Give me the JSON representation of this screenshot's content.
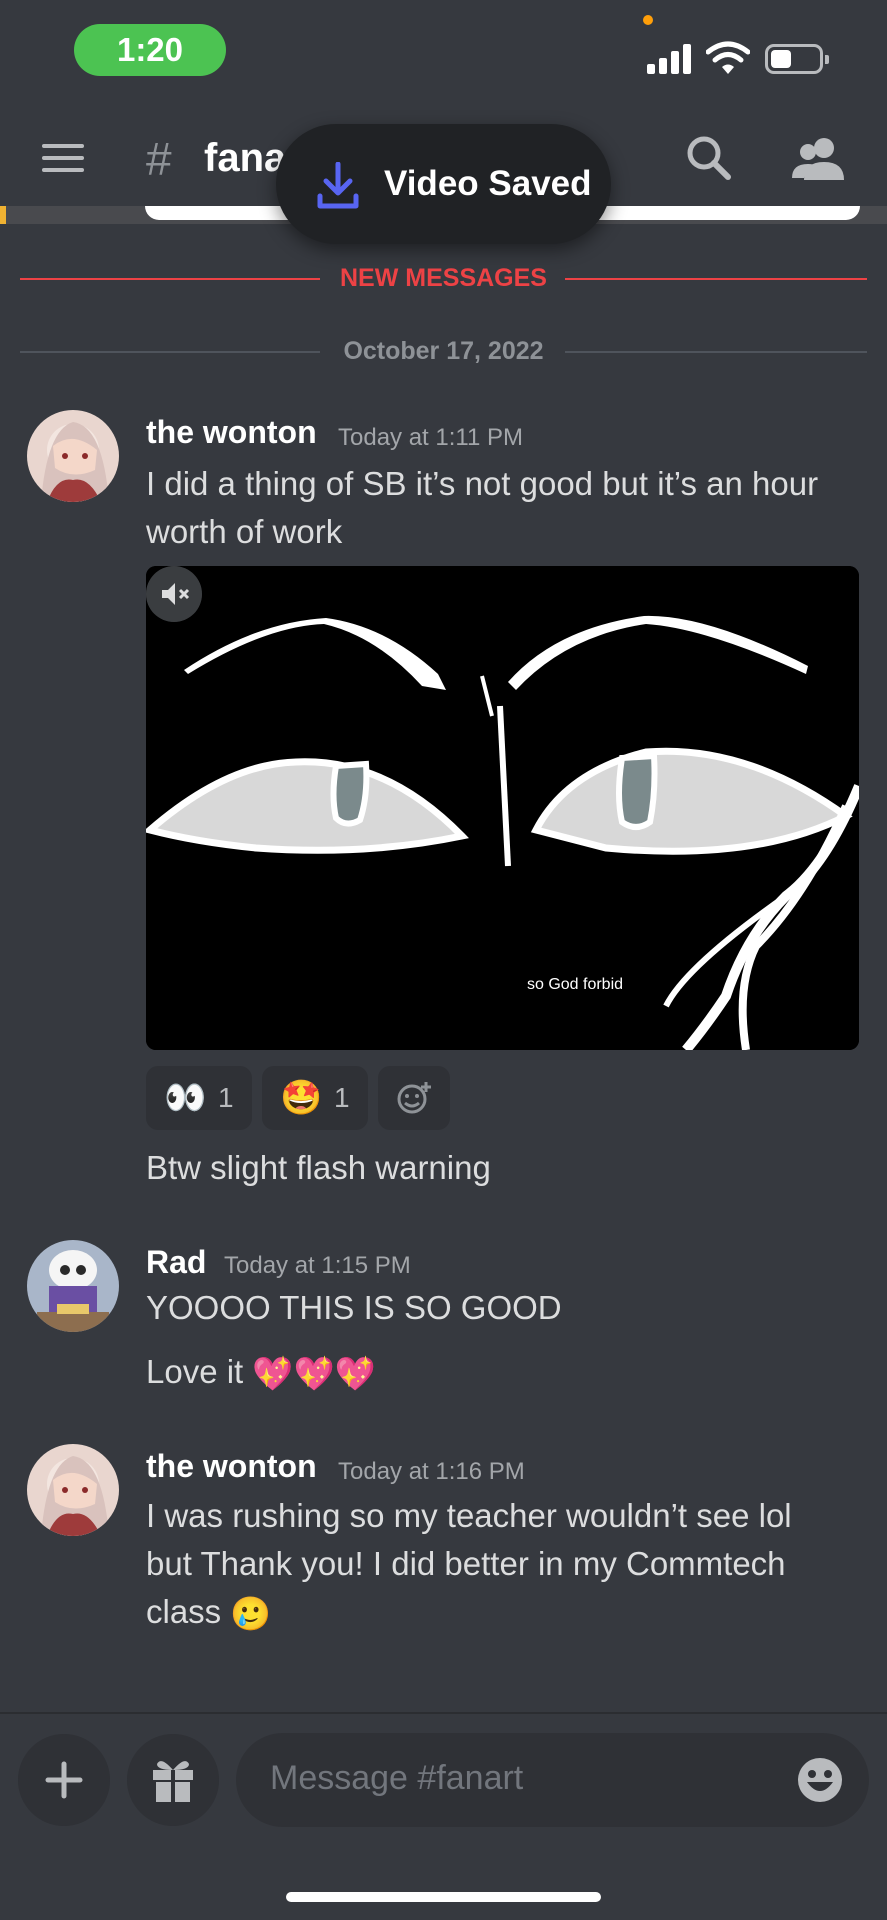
{
  "status_bar": {
    "time": "1:20"
  },
  "header": {
    "channel_name": "fana"
  },
  "toast": {
    "text": "Video Saved"
  },
  "dividers": {
    "new_messages": "NEW MESSAGES",
    "date": "October 17, 2022"
  },
  "messages": [
    {
      "author": "the wonton",
      "timestamp": "Today at 1:11 PM",
      "lines": [
        "I did a thing of SB it’s not good but it’s an hour",
        "worth of work"
      ],
      "video": {
        "subtitle": "so God forbid"
      },
      "reactions": [
        {
          "emoji": "👀",
          "count": "1"
        },
        {
          "emoji": "🤩",
          "count": "1"
        }
      ],
      "followup": "Btw slight flash warning"
    },
    {
      "author": "Rad",
      "timestamp": "Today at 1:15 PM",
      "line1": "YOOOO THIS IS SO GOOD",
      "line2": "Love it",
      "line2_emoji": "💖💖💖"
    },
    {
      "author": "the wonton",
      "timestamp": "Today at 1:16 PM",
      "lines": [
        "I was rushing so my teacher wouldn’t see lol",
        "but Thank you! I did better in my Commtech",
        "class"
      ],
      "emoji": "🥲"
    }
  ],
  "composer": {
    "placeholder": "Message #fanart"
  }
}
